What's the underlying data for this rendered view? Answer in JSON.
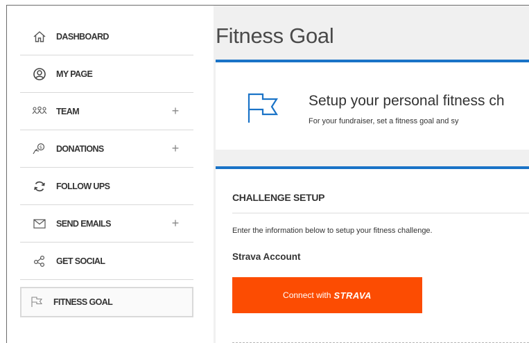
{
  "sidebar": {
    "items": [
      {
        "label": "DASHBOARD",
        "icon": "home-icon",
        "expandable": false
      },
      {
        "label": "MY PAGE",
        "icon": "user-circle-icon",
        "expandable": false
      },
      {
        "label": "TEAM",
        "icon": "team-icon",
        "expandable": true,
        "plus": "+"
      },
      {
        "label": "DONATIONS",
        "icon": "donation-icon",
        "expandable": true,
        "plus": "+"
      },
      {
        "label": "FOLLOW UPS",
        "icon": "refresh-icon",
        "expandable": false
      },
      {
        "label": "SEND EMAILS",
        "icon": "envelope-icon",
        "expandable": true,
        "plus": "+"
      },
      {
        "label": "GET SOCIAL",
        "icon": "share-icon",
        "expandable": false
      },
      {
        "label": "FITNESS GOAL",
        "icon": "flag-icon",
        "expandable": false,
        "active": true
      }
    ]
  },
  "main": {
    "title": "Fitness Goal",
    "intro": {
      "headline": "Setup your personal fitness ch",
      "subline": "For your fundraiser, set a fitness goal and sy",
      "icon": "flag-icon"
    },
    "challenge": {
      "section_title": "CHALLENGE SETUP",
      "instructions": "Enter the information below to setup your fitness challenge.",
      "field_label": "Strava Account",
      "button_prefix": "Connect with",
      "button_brand": "STRAVA"
    }
  },
  "colors": {
    "accent": "#1a73c7",
    "strava": "#fc4c02",
    "background": "#f0f0f0"
  }
}
